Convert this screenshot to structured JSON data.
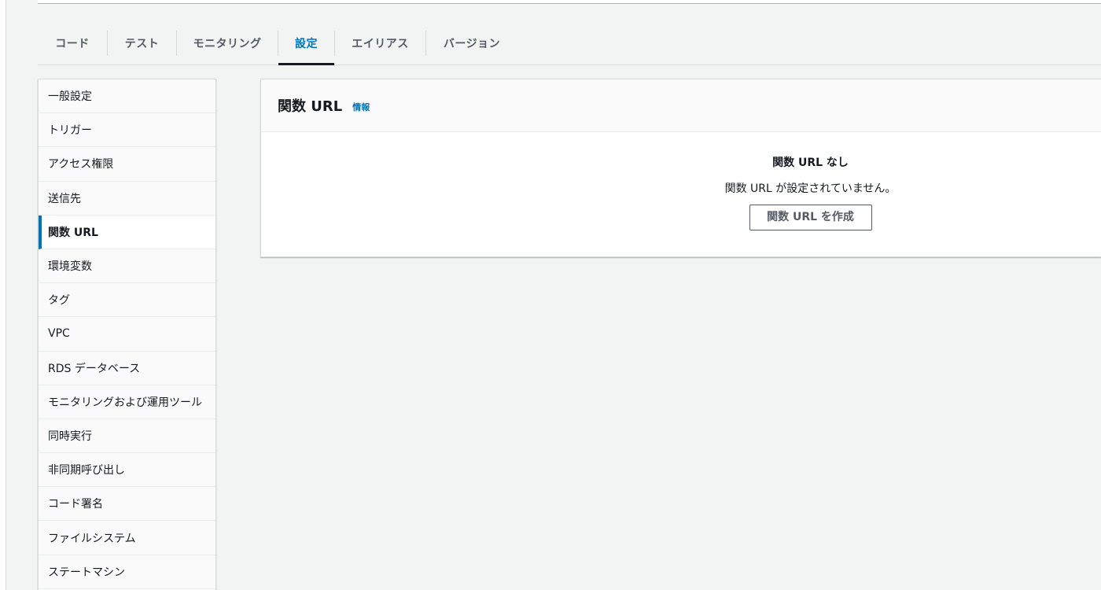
{
  "tabs": [
    {
      "label": "コード",
      "active": false
    },
    {
      "label": "テスト",
      "active": false
    },
    {
      "label": "モニタリング",
      "active": false
    },
    {
      "label": "設定",
      "active": true
    },
    {
      "label": "エイリアス",
      "active": false
    },
    {
      "label": "バージョン",
      "active": false
    }
  ],
  "sidenav": {
    "items": [
      {
        "label": "一般設定"
      },
      {
        "label": "トリガー"
      },
      {
        "label": "アクセス権限"
      },
      {
        "label": "送信先"
      },
      {
        "label": "関数 URL",
        "active": true
      },
      {
        "label": "環境変数"
      },
      {
        "label": "タグ"
      },
      {
        "label": "VPC"
      },
      {
        "label": "RDS データベース"
      },
      {
        "label": "モニタリングおよび運用ツール"
      },
      {
        "label": "同時実行"
      },
      {
        "label": "非同期呼び出し"
      },
      {
        "label": "コード署名"
      },
      {
        "label": "ファイルシステム"
      },
      {
        "label": "ステートマシン"
      }
    ]
  },
  "panel": {
    "title": "関数 URL",
    "info_link": "情報",
    "empty_title": "関数 URL なし",
    "empty_description": "関数 URL が設定されていません。",
    "create_button": "関数 URL を作成"
  },
  "colors": {
    "accent": "#0073bb",
    "background": "#f2f3f3",
    "text": "#16191f",
    "muted": "#545b64"
  }
}
